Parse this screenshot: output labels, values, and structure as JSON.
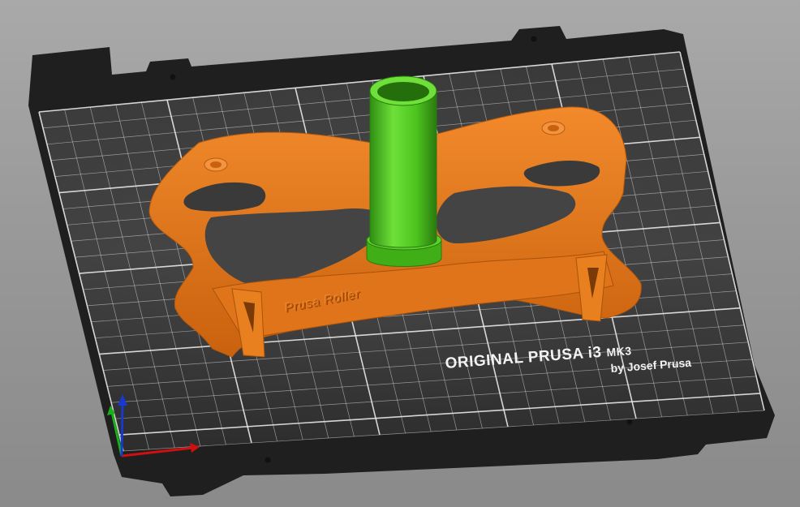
{
  "bed": {
    "brand_line": "ORIGINAL PRUSA i3",
    "model_label": "MK3",
    "byline": "by Josef Prusa"
  },
  "objects": [
    {
      "name": "Prusa Roller frame",
      "color": "#e47a1e",
      "embossed_text": "Prusa Roller"
    },
    {
      "name": "spool tube",
      "color": "#4cc41e"
    }
  ],
  "colors": {
    "background": "#9c9c9c",
    "bed_plate": "#2c2c2c",
    "bed_grid": "#ffffff",
    "axis_x": "#d01010",
    "axis_y": "#18b018",
    "axis_z": "#1838d0"
  }
}
